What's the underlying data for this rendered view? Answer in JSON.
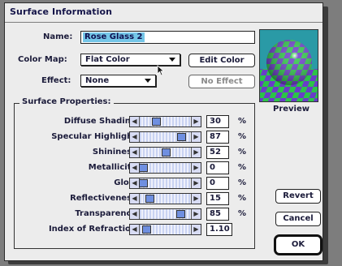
{
  "window": {
    "title": "Surface Information"
  },
  "name": {
    "label": "Name:",
    "value": "Rose Glass 2"
  },
  "color_map": {
    "label": "Color Map:",
    "value": "Flat Color",
    "edit_label": "Edit Color"
  },
  "effect": {
    "label": "Effect:",
    "value": "None",
    "button_label": "No Effect"
  },
  "preview": {
    "label": "Preview"
  },
  "properties": {
    "label": "Surface Properties:",
    "rows": [
      {
        "label": "Diffuse Shading",
        "value": "30",
        "unit": "%",
        "level": 0.3
      },
      {
        "label": "Specular Highlight",
        "value": "87",
        "unit": "%",
        "level": 0.87
      },
      {
        "label": "Shininess",
        "value": "52",
        "unit": "%",
        "level": 0.52
      },
      {
        "label": "Metallicity",
        "value": "0",
        "unit": "%",
        "level": 0.0
      },
      {
        "label": "Glow",
        "value": "0",
        "unit": "%",
        "level": 0.0
      },
      {
        "label": "Reflectiveness",
        "value": "15",
        "unit": "%",
        "level": 0.15
      },
      {
        "label": "Transparency",
        "value": "85",
        "unit": "%",
        "level": 0.85
      },
      {
        "label": "Index of Refraction",
        "value": "1.10",
        "unit": "",
        "level": 0.08
      }
    ]
  },
  "buttons": {
    "revert": "Revert",
    "cancel": "Cancel",
    "ok": "OK"
  },
  "colors": {
    "selection": "#74c6e8",
    "thumb": "#6f8fe0",
    "preview_green": "#2cc447",
    "preview_purple": "#6a3cc8"
  }
}
